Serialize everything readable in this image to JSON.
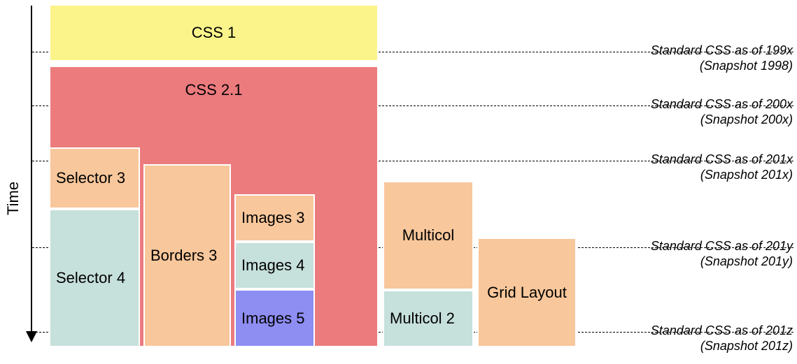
{
  "axis": {
    "label": "Time"
  },
  "timeline": {
    "snapshots": [
      {
        "title": "Standard CSS as of 199x",
        "subtitle": "(Snapshot 1998)"
      },
      {
        "title": "Standard CSS as of 200x",
        "subtitle": "(Snapshot 200x)"
      },
      {
        "title": "Standard CSS as of 201x",
        "subtitle": "(Snapshot 201x)"
      },
      {
        "title": "Standard CSS as of 201y",
        "subtitle": "(Snapshot 201y)"
      },
      {
        "title": "Standard CSS as of 201z",
        "subtitle": "(Snapshot 201z)"
      }
    ],
    "blocks": {
      "css1": {
        "label": "CSS 1",
        "color": "yellow"
      },
      "css21": {
        "label": "CSS 2.1",
        "color": "red"
      },
      "selector3": {
        "label": "Selector 3",
        "color": "orange"
      },
      "selector4": {
        "label": "Selector 4",
        "color": "teal"
      },
      "borders3": {
        "label": "Borders 3",
        "color": "orange"
      },
      "images3": {
        "label": "Images 3",
        "color": "orange"
      },
      "images4": {
        "label": "Images 4",
        "color": "teal"
      },
      "images5": {
        "label": "Images 5",
        "color": "blue"
      },
      "multicol": {
        "label": "Multicol",
        "color": "orange"
      },
      "multicol2": {
        "label": "Multicol 2",
        "color": "teal"
      },
      "gridlayout": {
        "label": "Grid Layout",
        "color": "orange"
      }
    }
  }
}
